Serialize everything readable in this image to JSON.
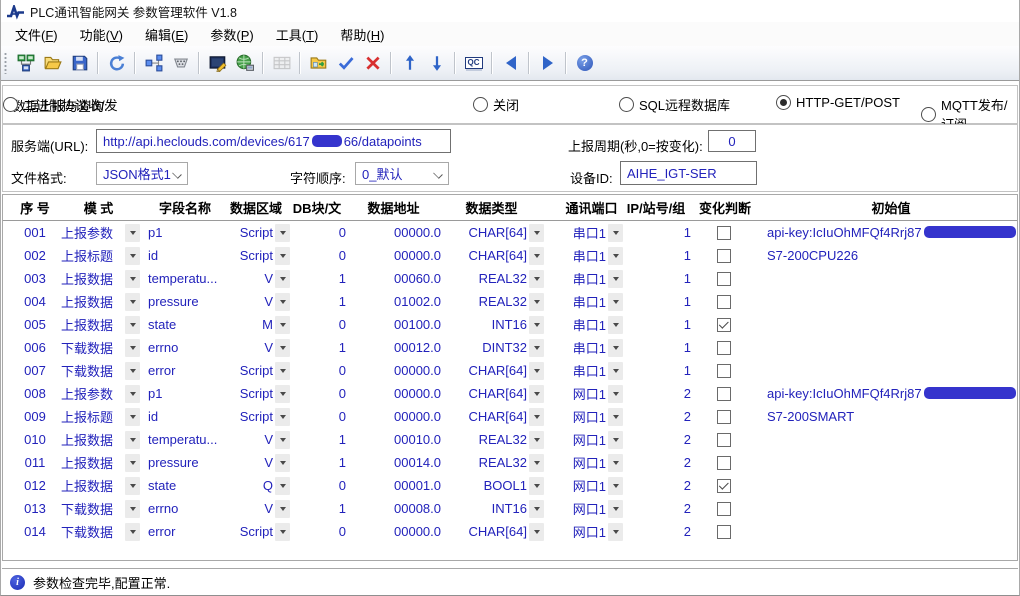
{
  "window": {
    "title": "PLC通讯智能网关 参数管理软件 V1.8"
  },
  "menu": {
    "items": [
      {
        "pre": "文件(",
        "key": "F",
        "post": ")"
      },
      {
        "pre": "功能(",
        "key": "V",
        "post": ")"
      },
      {
        "pre": "编辑(",
        "key": "E",
        "post": ")"
      },
      {
        "pre": "参数(",
        "key": "P",
        "post": ")"
      },
      {
        "pre": "工具(",
        "key": "T",
        "post": ")"
      },
      {
        "pre": "帮助(",
        "key": "H",
        "post": ")"
      }
    ]
  },
  "toolbar": {
    "icons": [
      "connect-icon",
      "open-folder-icon",
      "save-icon",
      "refresh-icon",
      "topology-icon",
      "serial-port-icon",
      "device-edit-icon",
      "network-globe-icon",
      "table-icon-disabled",
      "folder-export-icon",
      "check-icon",
      "delete-icon",
      "up-arrow-icon",
      "down-arrow-icon",
      "qc-icon",
      "prev-icon",
      "next-icon",
      "help-icon"
    ],
    "qc_label": "QC",
    "help_glyph": "?"
  },
  "report_panel": {
    "label": "数据上报与查询:",
    "options": [
      {
        "label": "关闭",
        "selected": false
      },
      {
        "label": "SQL远程数据库",
        "selected": false
      },
      {
        "label": "HTTP-GET/POST",
        "selected": true
      },
      {
        "label": "MQTT发布/订阅",
        "selected": false
      },
      {
        "label": "二进制协议收/发",
        "selected": false
      }
    ]
  },
  "params": {
    "url_label": "服务端(URL):",
    "url_prefix": "http://api.heclouds.com/devices/617",
    "url_redacted": true,
    "url_suffix": "66/datapoints",
    "period_label": "上报周期(秒,0=按变化):",
    "period_value": "0",
    "format_label": "文件格式:",
    "format_value": "JSON格式1",
    "order_label": "字符顺序:",
    "order_value": "0_默认",
    "device_label": "设备ID:",
    "device_value": "AIHE_IGT-SER"
  },
  "table": {
    "headers": [
      "序 号",
      "模 式",
      "字段名称",
      "数据区域",
      "DB块/文",
      "数据地址",
      "数据类型",
      "通讯端口",
      "IP/站号/组",
      "变化判断",
      "初始值"
    ],
    "rows": [
      {
        "seq": "001",
        "mode": "上报参数",
        "field": "p1",
        "area": "Script",
        "db": "0",
        "addr": "00000.0",
        "type": "CHAR[64]",
        "port": "串口1",
        "station": "1",
        "checked": false,
        "init_pre": "api-key:IcIuOhMFQf4Rrj87",
        "init_redact": true,
        "init_post": "="
      },
      {
        "seq": "002",
        "mode": "上报标题",
        "field": "id",
        "area": "Script",
        "db": "0",
        "addr": "00000.0",
        "type": "CHAR[64]",
        "port": "串口1",
        "station": "1",
        "checked": false,
        "init_pre": "S7-200CPU226",
        "init_redact": false,
        "init_post": ""
      },
      {
        "seq": "003",
        "mode": "上报数据",
        "field": "temperatu...",
        "area": "V",
        "db": "1",
        "addr": "00060.0",
        "type": "REAL32",
        "port": "串口1",
        "station": "1",
        "checked": false,
        "init_pre": "",
        "init_redact": false,
        "init_post": ""
      },
      {
        "seq": "004",
        "mode": "上报数据",
        "field": "pressure",
        "area": "V",
        "db": "1",
        "addr": "01002.0",
        "type": "REAL32",
        "port": "串口1",
        "station": "1",
        "checked": false,
        "init_pre": "",
        "init_redact": false,
        "init_post": ""
      },
      {
        "seq": "005",
        "mode": "上报数据",
        "field": "state",
        "area": "M",
        "db": "0",
        "addr": "00100.0",
        "type": "INT16",
        "port": "串口1",
        "station": "1",
        "checked": true,
        "init_pre": "",
        "init_redact": false,
        "init_post": ""
      },
      {
        "seq": "006",
        "mode": "下载数据",
        "field": "errno",
        "area": "V",
        "db": "1",
        "addr": "00012.0",
        "type": "DINT32",
        "port": "串口1",
        "station": "1",
        "checked": false,
        "init_pre": "",
        "init_redact": false,
        "init_post": ""
      },
      {
        "seq": "007",
        "mode": "下载数据",
        "field": "error",
        "area": "Script",
        "db": "0",
        "addr": "00000.0",
        "type": "CHAR[64]",
        "port": "串口1",
        "station": "1",
        "checked": false,
        "init_pre": "",
        "init_redact": false,
        "init_post": ""
      },
      {
        "seq": "008",
        "mode": "上报参数",
        "field": "p1",
        "area": "Script",
        "db": "0",
        "addr": "00000.0",
        "type": "CHAR[64]",
        "port": "网口1",
        "station": "2",
        "checked": false,
        "init_pre": "api-key:IcIuOhMFQf4Rrj87",
        "init_redact": true,
        "init_post": "g="
      },
      {
        "seq": "009",
        "mode": "上报标题",
        "field": "id",
        "area": "Script",
        "db": "0",
        "addr": "00000.0",
        "type": "CHAR[64]",
        "port": "网口1",
        "station": "2",
        "checked": false,
        "init_pre": "S7-200SMART",
        "init_redact": false,
        "init_post": ""
      },
      {
        "seq": "010",
        "mode": "上报数据",
        "field": "temperatu...",
        "area": "V",
        "db": "1",
        "addr": "00010.0",
        "type": "REAL32",
        "port": "网口1",
        "station": "2",
        "checked": false,
        "init_pre": "",
        "init_redact": false,
        "init_post": ""
      },
      {
        "seq": "011",
        "mode": "上报数据",
        "field": "pressure",
        "area": "V",
        "db": "1",
        "addr": "00014.0",
        "type": "REAL32",
        "port": "网口1",
        "station": "2",
        "checked": false,
        "init_pre": "",
        "init_redact": false,
        "init_post": ""
      },
      {
        "seq": "012",
        "mode": "上报数据",
        "field": "state",
        "area": "Q",
        "db": "0",
        "addr": "00001.0",
        "type": "BOOL1",
        "port": "网口1",
        "station": "2",
        "checked": true,
        "init_pre": "",
        "init_redact": false,
        "init_post": ""
      },
      {
        "seq": "013",
        "mode": "下载数据",
        "field": "errno",
        "area": "V",
        "db": "1",
        "addr": "00008.0",
        "type": "INT16",
        "port": "网口1",
        "station": "2",
        "checked": false,
        "init_pre": "",
        "init_redact": false,
        "init_post": ""
      },
      {
        "seq": "014",
        "mode": "下载数据",
        "field": "error",
        "area": "Script",
        "db": "0",
        "addr": "00000.0",
        "type": "CHAR[64]",
        "port": "网口1",
        "station": "2",
        "checked": false,
        "init_pre": "",
        "init_redact": false,
        "init_post": ""
      }
    ]
  },
  "statusbar": {
    "icon_glyph": "i",
    "message": "参数检查完毕,配置正常."
  },
  "colors": {
    "value_text": "#2222bb",
    "redaction": "#3534cd",
    "status_icon": "#1b2cb4",
    "toolbar_accent": "#2f64c8"
  }
}
